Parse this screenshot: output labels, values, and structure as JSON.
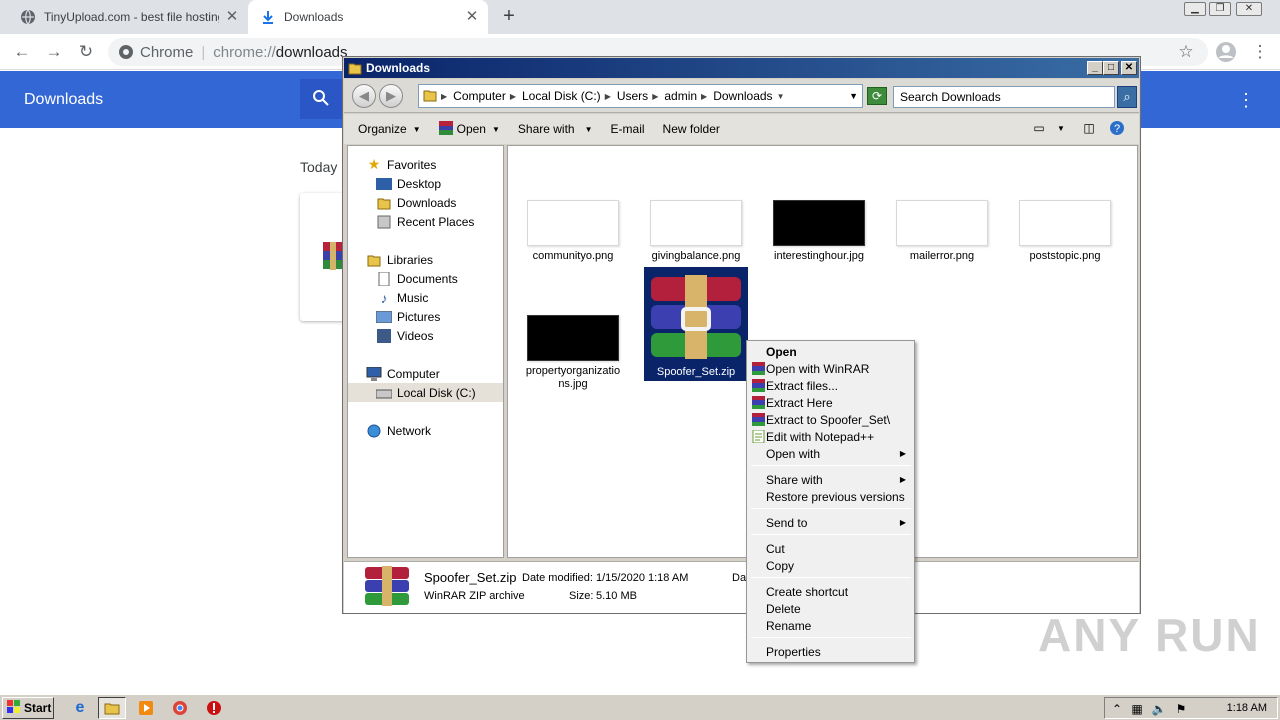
{
  "chrome": {
    "tabs": [
      {
        "title": "TinyUpload.com - best file hosting so"
      },
      {
        "title": "Downloads"
      }
    ],
    "omnibox": {
      "site_label": "Chrome",
      "url_scheme": "chrome://",
      "url_host": "downloads"
    },
    "page": {
      "title": "Downloads",
      "section": "Today"
    }
  },
  "explorer": {
    "title": "Downloads",
    "breadcrumbs": [
      "Computer",
      "Local Disk (C:)",
      "Users",
      "admin",
      "Downloads"
    ],
    "search_placeholder": "Search Downloads",
    "commands": {
      "organize": "Organize",
      "open": "Open",
      "share_with": "Share with",
      "email": "E-mail",
      "new_folder": "New folder"
    },
    "nav": {
      "favorites": "Favorites",
      "desktop": "Desktop",
      "downloads": "Downloads",
      "recent_places": "Recent Places",
      "libraries": "Libraries",
      "documents": "Documents",
      "music": "Music",
      "pictures": "Pictures",
      "videos": "Videos",
      "computer": "Computer",
      "local_disk": "Local Disk (C:)",
      "network": "Network"
    },
    "files": {
      "f1": "communityo.png",
      "f2": "givingbalance.png",
      "f3": "interestinghour.jpg",
      "f4": "mailerror.png",
      "f5": "poststopic.png",
      "f6": "propertyorganizations.jpg",
      "f7": "Spoofer_Set.zip"
    },
    "details": {
      "name": "Spoofer_Set.zip",
      "type": "WinRAR ZIP archive",
      "date_label": "Date modified:",
      "date_value": "1/15/2020 1:18 AM",
      "size_label": "Size:",
      "size_value": "5.10 MB",
      "truncated_label": "Dat"
    }
  },
  "context_menu": {
    "open": "Open",
    "open_winrar": "Open with WinRAR",
    "extract_files": "Extract files...",
    "extract_here": "Extract Here",
    "extract_to": "Extract to Spoofer_Set\\",
    "edit_notepad": "Edit with Notepad++",
    "open_with": "Open with",
    "share_with": "Share with",
    "restore": "Restore previous versions",
    "send_to": "Send to",
    "cut": "Cut",
    "copy": "Copy",
    "create_shortcut": "Create shortcut",
    "delete": "Delete",
    "rename": "Rename",
    "properties": "Properties"
  },
  "taskbar": {
    "start": "Start",
    "clock": "1:18 AM"
  },
  "watermark": "ANY RUN",
  "colors": {
    "chrome_header": "#3367d6",
    "selection": "#0a246a"
  }
}
